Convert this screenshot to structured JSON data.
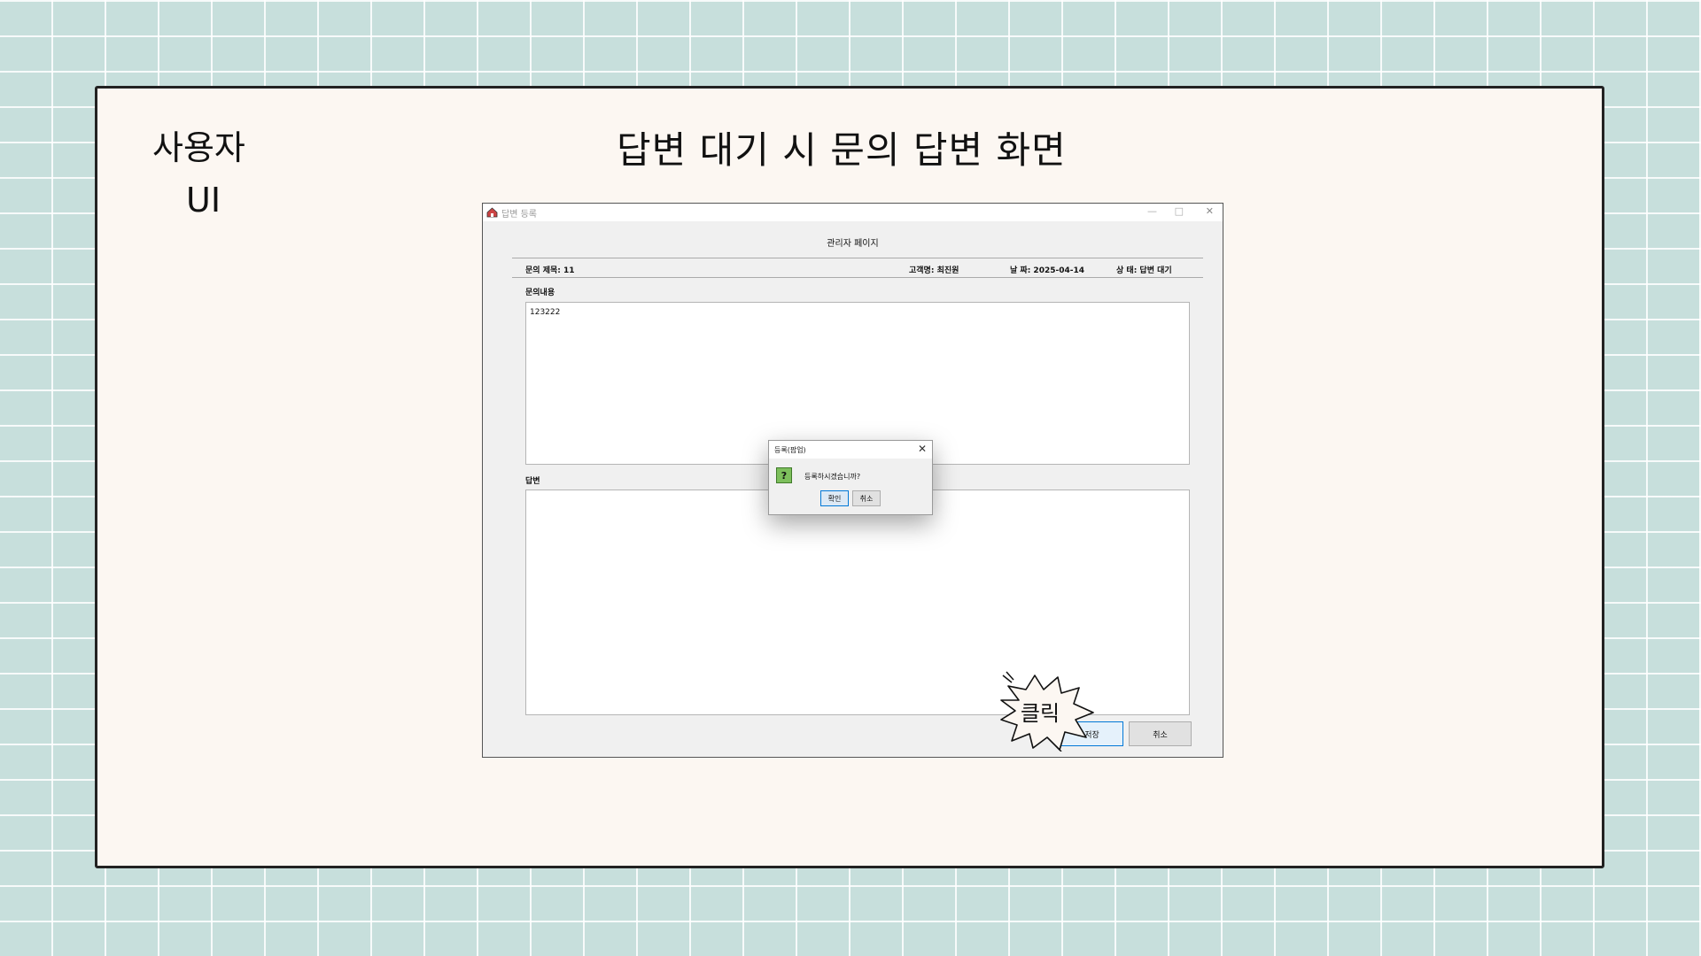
{
  "slide": {
    "title": "답변 대기 시 문의 답변 화면",
    "label_user": "사용자",
    "label_ui": "UI"
  },
  "window": {
    "title": "답변 등록",
    "controls": {
      "minimize": "—",
      "maximize": "□",
      "close": "✕"
    },
    "admin_title": "관리자 페이지",
    "info": {
      "subject": "문의 제목: 11",
      "customer": "고객명: 최진원",
      "date": "날 짜: 2025-04-14",
      "status": "상 태: 답변 대기"
    },
    "inquiry_label": "문의내용",
    "inquiry_content": "123222",
    "answer_label": "답변",
    "answer_content": "",
    "save_button": "저장",
    "cancel_button": "취소"
  },
  "dialog": {
    "title": "등록(팝업)",
    "close": "✕",
    "message": "등록하시겠습니까?",
    "ok_button": "확인",
    "cancel_button": "취소"
  },
  "callout": {
    "text": "클릭"
  },
  "icons": {
    "app": "app-house-icon",
    "question": "question-mark-icon"
  },
  "colors": {
    "background": "#c7dfdc",
    "card": "#fcf7f2",
    "question_icon": "#7dbf5c",
    "focus": "#0078d7"
  }
}
